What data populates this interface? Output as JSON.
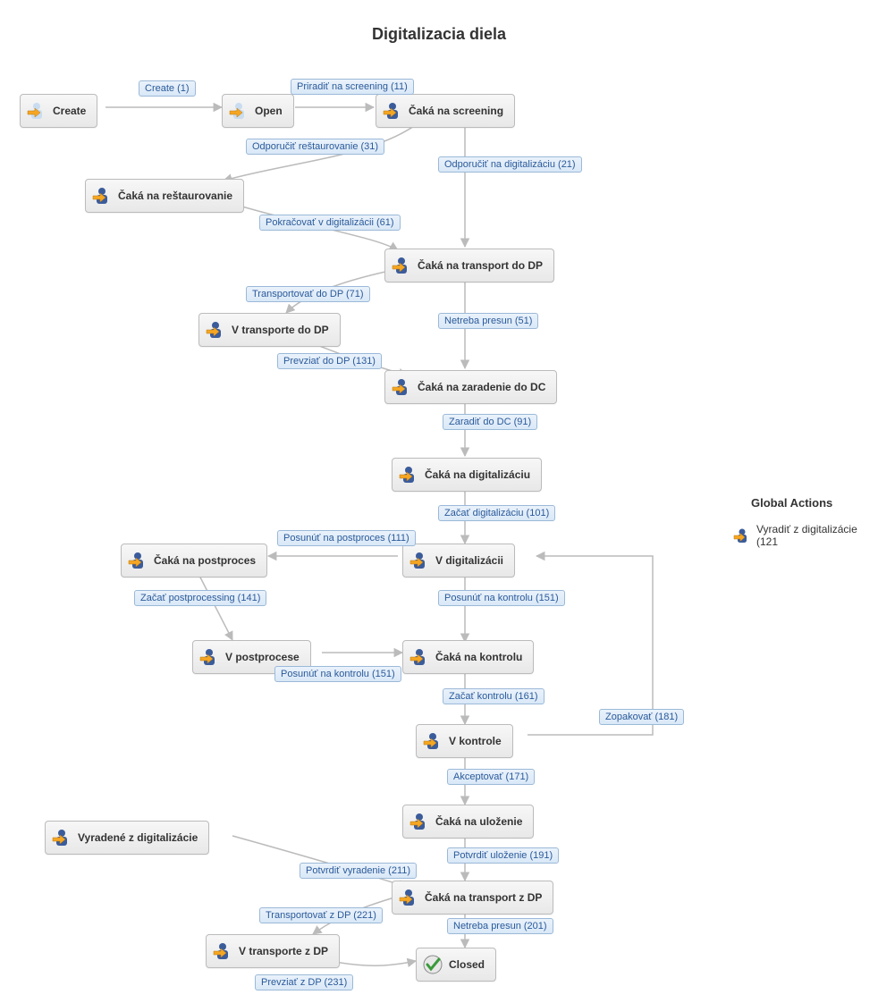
{
  "title": "Digitalizacia diela",
  "global_actions": {
    "heading": "Global Actions",
    "items": [
      "Vyradiť z digitalizácie (121"
    ]
  },
  "statuses": {
    "create": "Create",
    "open": "Open",
    "caka_screening": "Čaká na screening",
    "caka_restaurovanie": "Čaká na reštaurovanie",
    "caka_transport_do_dp": "Čaká na transport do DP",
    "v_transporte_do_dp": "V transporte do DP",
    "caka_zaradenie_dc": "Čaká na zaradenie do DC",
    "caka_digitalizaciu": "Čaká na digitalizáciu",
    "v_digitalizacii": "V digitalizácii",
    "caka_postproces": "Čaká na postproces",
    "v_postprocese": "V postprocese",
    "caka_kontrolu": "Čaká na kontrolu",
    "v_kontrole": "V kontrole",
    "caka_ulozenie": "Čaká na uloženie",
    "vyradene": "Vyradené z digitalizácie",
    "caka_transport_z_dp": "Čaká na transport z DP",
    "v_transporte_z_dp": "V transporte z DP",
    "closed": "Closed"
  },
  "transitions": {
    "create": "Create (1)",
    "priradit_screening": "Priradiť na screening (11)",
    "odporucit_restaurovanie": "Odporučiť reštaurovanie (31)",
    "odporucit_digitalizaciu": "Odporučiť na digitalizáciu (21)",
    "pokracovat_digitalizacii": "Pokračovať v digitalizácii (61)",
    "transportovat_do_dp": "Transportovať do DP (71)",
    "netreba_presun_51": "Netreba presun (51)",
    "prevziat_do_dp": "Prevziať do DP (131)",
    "zaradit_do_dc": "Zaradiť do DC (91)",
    "zacat_digitalizaciu": "Začať digitalizáciu (101)",
    "posunut_postproces": "Posunúť na postproces (111)",
    "posunut_kontrolu_151a": "Posunúť na kontrolu (151)",
    "zacat_postprocessing": "Začať postprocessing (141)",
    "posunut_kontrolu_151b": "Posunúť na kontrolu (151)",
    "zacat_kontrolu": "Začať kontrolu (161)",
    "zopakovat": "Zopakovať (181)",
    "akceptovat": "Akceptovať (171)",
    "potvrdit_ulozenie": "Potvrdiť uloženie (191)",
    "potvrdit_vyradenie": "Potvrdiť vyradenie (211)",
    "transportovat_z_dp": "Transportovať z DP (221)",
    "netreba_presun_201": "Netreba presun (201)",
    "prevziat_z_dp": "Prevziať z DP (231)"
  }
}
